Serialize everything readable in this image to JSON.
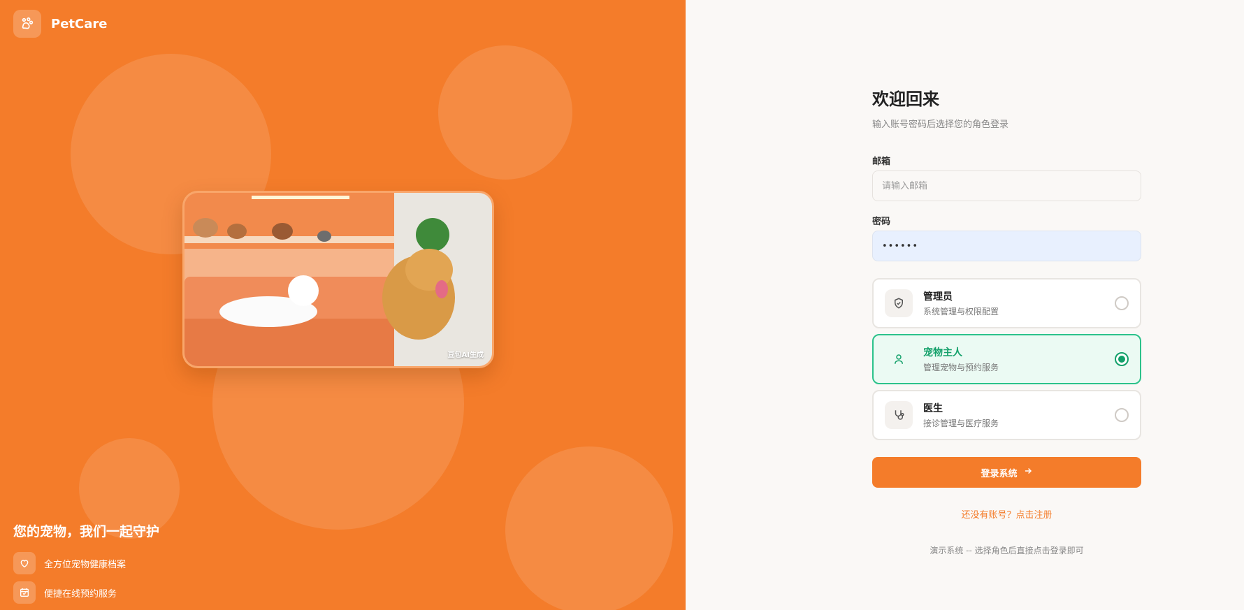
{
  "brand": {
    "name": "PetCare",
    "logo_icon": "paw-icon"
  },
  "hero": {
    "image_caption": "豆包AI生成",
    "tagline": "您的宠物，我们一起守护",
    "features": [
      {
        "icon": "heart-icon",
        "label": "全方位宠物健康档案"
      },
      {
        "icon": "calendar-icon",
        "label": "便捷在线预约服务"
      }
    ]
  },
  "login": {
    "title": "欢迎回来",
    "subtitle": "输入账号密码后选择您的角色登录",
    "email_label": "邮箱",
    "email_placeholder": "请输入邮箱",
    "email_value": "",
    "password_label": "密码",
    "password_value": "••••••",
    "roles": [
      {
        "name": "管理员",
        "desc": "系统管理与权限配置",
        "icon": "shield-check-icon",
        "selected": false
      },
      {
        "name": "宠物主人",
        "desc": "管理宠物与预约服务",
        "icon": "user-icon",
        "selected": true
      },
      {
        "name": "医生",
        "desc": "接诊管理与医疗服务",
        "icon": "stethoscope-icon",
        "selected": false
      }
    ],
    "submit_label": "登录系统",
    "register_text": "还没有账号？点击注册",
    "demo_note": "演示系统 -- 选择角色后直接点击登录即可"
  },
  "colors": {
    "primary": "#f47c2a",
    "success": "#13a06a",
    "success_bg": "#ebfaf3",
    "background_right": "#faf8f6"
  }
}
